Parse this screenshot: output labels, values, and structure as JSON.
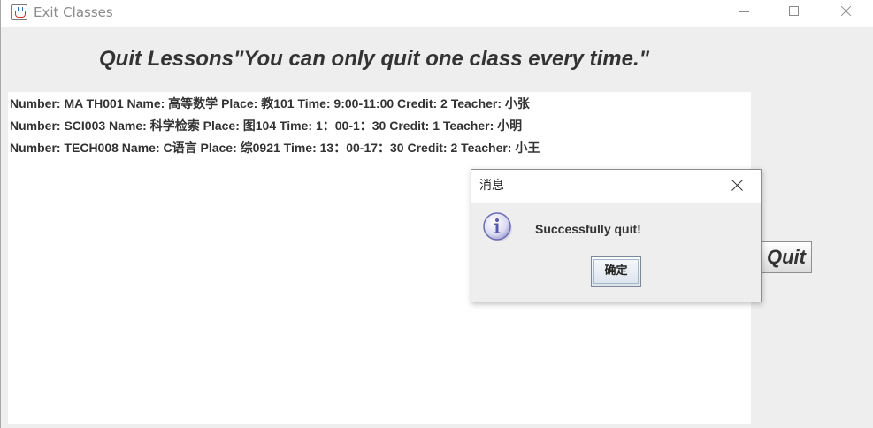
{
  "window": {
    "title": "Exit Classes",
    "icon": "java-cup-icon"
  },
  "heading": "Quit Lessons\"You can only quit one class every time.\"",
  "classes": [
    "Number: MA TH001 Name: 高等数学 Place: 教101 Time: 9:00-11:00 Credit: 2 Teacher: 小张",
    "Number: SCI003 Name: 科学检索 Place: 图104 Time: 1：00-1：30 Credit: 1 Teacher: 小明",
    "Number: TECH008 Name: C语言 Place: 综0921 Time: 13：00-17：30 Credit: 2 Teacher: 小王"
  ],
  "quit_button": "Quit",
  "dialog": {
    "title": "消息",
    "icon": "info-icon",
    "message": "Successfully quit!",
    "ok_label": "确定"
  }
}
